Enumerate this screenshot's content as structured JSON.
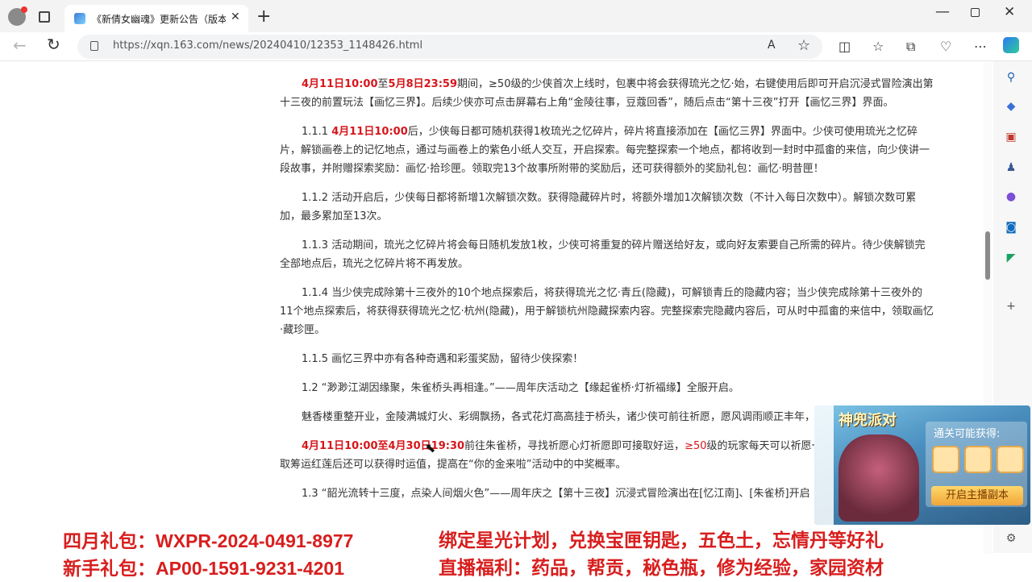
{
  "browser": {
    "tab_title": "《新倩女幽魂》更新公告（版本",
    "tab_close": "✕",
    "new_tab": "+",
    "url": "https://xqn.163.com/news/20240410/12353_1148426.html",
    "read_aloud": "A",
    "window": {
      "min": "—",
      "close": "✕"
    }
  },
  "article": {
    "p1": {
      "red1": "4月11日10:00",
      "t1": "至",
      "red2": "5月8日23:59",
      "t2": "期间，≥50级的少侠首次上线时，包裹中将会获得琉光之忆·始，右键使用后即可开启沉浸式冒险演出第十三夜的前置玩法【画忆三界】。后续少侠亦可点击屏幕右上角“金陵往事，豆蔻回香”，随后点击“第十三夜”打开【画忆三界】界面。"
    },
    "p2": {
      "num": "1.1.1 ",
      "red": "4月11日10:00",
      "text": "后，少侠每日都可随机获得1枚琉光之忆碎片，碎片将直接添加在【画忆三界】界面中。少侠可使用琉光之忆碎片，解锁画卷上的记忆地点，通过与画卷上的紫色小纸人交互，开启探索。每完整探索一个地点，都将收到一封时中孤畬的来信，向少侠讲一段故事，并附赠探索奖励：画忆·拾珍匣。领取完13个故事所附带的奖励后，还可获得额外的奖励礼包：画忆·明昔匣！"
    },
    "p3": "1.1.2 活动开启后，少侠每日都将新增1次解锁次数。获得隐藏碎片时，将额外增加1次解锁次数（不计入每日次数中）。解锁次数可累加，最多累加至13次。",
    "p4": "1.1.3 活动期间，琉光之忆碎片将会每日随机发放1枚，少侠可将重复的碎片赠送给好友，或向好友索要自己所需的碎片。待少侠解锁完全部地点后，琉光之忆碎片将不再发放。",
    "p5": "1.1.4 当少侠完成除第十三夜外的10个地点探索后，将获得琉光之忆·青丘(隐藏)，可解锁青丘的隐藏内容；当少侠完成除第十三夜外的11个地点探索后，将获得获得琉光之忆·杭州(隐藏)，用于解锁杭州隐藏探索内容。完整探索完隐藏内容后，可从时中孤畬的来信中，领取画忆·藏珍匣。",
    "p6": "1.1.5 画忆三界中亦有各种奇遇和彩蛋奖励，留待少侠探索！",
    "p7": "1.2 “渺渺江湖因缘聚，朱雀桥头再相逢。”——周年庆活动之【缘起雀桥·灯祈福缘】全服开启。",
    "p8": "魅香楼重整开业，金陵满城灯火、彩绸飘扬，各式花灯高高挂于桥头，诸少侠可前往祈愿，愿风调雨顺正丰年，天下太平永盛世！",
    "p9": {
      "red": "4月11日10:00至4月30日19:30",
      "t1": "前往朱雀桥，寻找祈愿心灯祈愿即可接取好运，",
      "red2": "≥50",
      "t2": "级的玩家每天可以祈愿一次，祈愿后在包裹中领取筹运红莲后还可以获得时运值，提高在“你的金来啦”活动中的中奖概率。"
    },
    "p10": "1.3 “韶光流转十三度，点染人间烟火色”——周年庆之【第十三夜】沉浸式冒险演出在[忆江南]、[朱雀桥]开启"
  },
  "ad": {
    "title": "神兜派对",
    "subtitle": "通关可能获得:",
    "button": "开启主播副本"
  },
  "overlay": {
    "line1_label": "四月礼包：",
    "line1_code": "WXPR-2024-0491-8977",
    "line1_desc": "绑定星光计划，兑换宝匣钥匙，五色土，忘情丹等好礼",
    "line2_label": "新手礼包：",
    "line2_code": "AP00-1591-9231-4201",
    "line2_desc": "直播福利：药品，帮贡，秘色瓶，修为经验，家园资材"
  }
}
